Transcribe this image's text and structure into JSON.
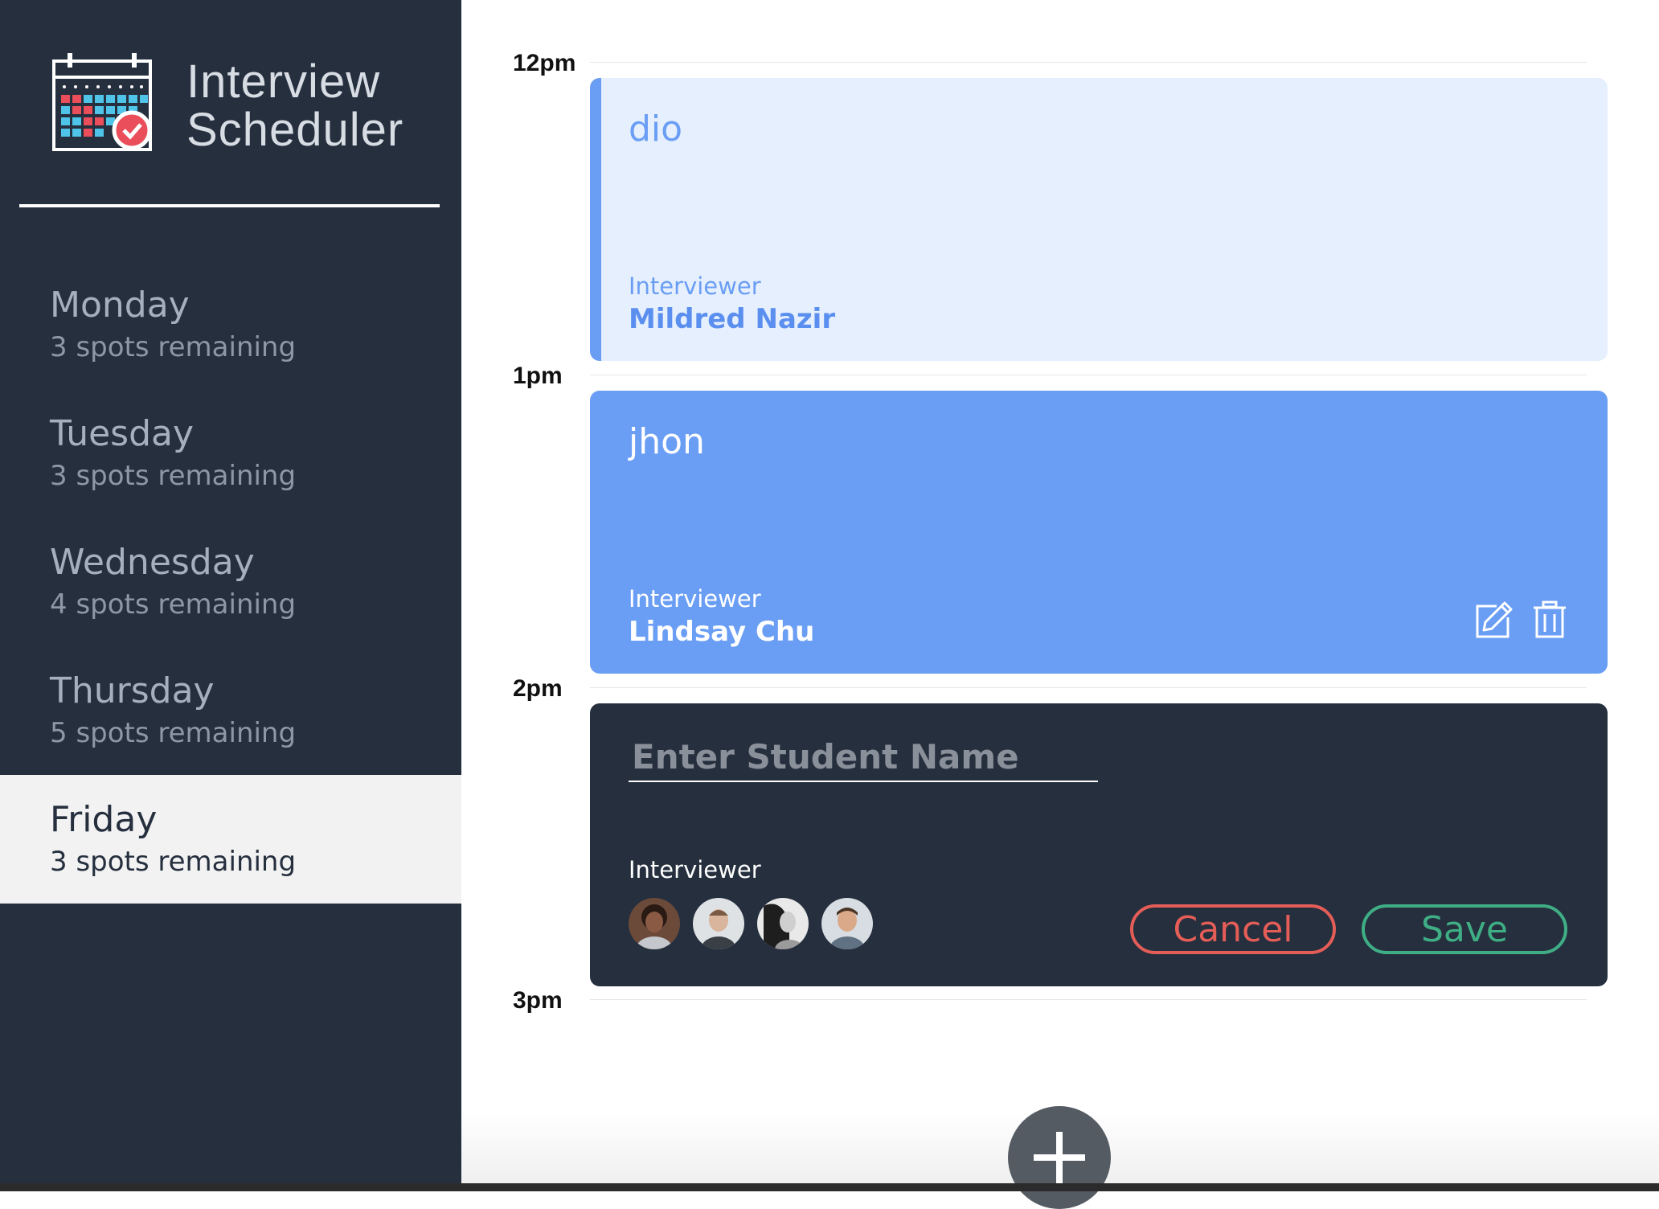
{
  "brand": {
    "line1": "Interview",
    "line2": "Scheduler",
    "logo_icon": "calendar-check-icon"
  },
  "sidebar": {
    "days": [
      {
        "name": "Monday",
        "spots": "3 spots remaining"
      },
      {
        "name": "Tuesday",
        "spots": "3 spots remaining"
      },
      {
        "name": "Wednesday",
        "spots": "4 spots remaining"
      },
      {
        "name": "Thursday",
        "spots": "5 spots remaining"
      },
      {
        "name": "Friday",
        "spots": "3 spots remaining",
        "selected": true
      }
    ]
  },
  "schedule": {
    "times": [
      "12pm",
      "1pm",
      "2pm",
      "3pm"
    ],
    "appointments": [
      {
        "student": "dio",
        "interviewer_label": "Interviewer",
        "interviewer": "Mildred Nazir",
        "state": "light"
      },
      {
        "student": "jhon",
        "interviewer_label": "Interviewer",
        "interviewer": "Lindsay Chu",
        "state": "hovered"
      }
    ],
    "form": {
      "placeholder": "Enter Student Name",
      "value": "",
      "interviewer_label": "Interviewer",
      "interviewer_count": 4,
      "cancel_label": "Cancel",
      "save_label": "Save"
    }
  },
  "colors": {
    "sidebar_bg": "#252f3e",
    "accent_blue": "#6a9ef4",
    "light_blue": "#e6effd",
    "cancel_red": "#e45d57",
    "save_green": "#3fae85",
    "add_button": "#555b63"
  }
}
